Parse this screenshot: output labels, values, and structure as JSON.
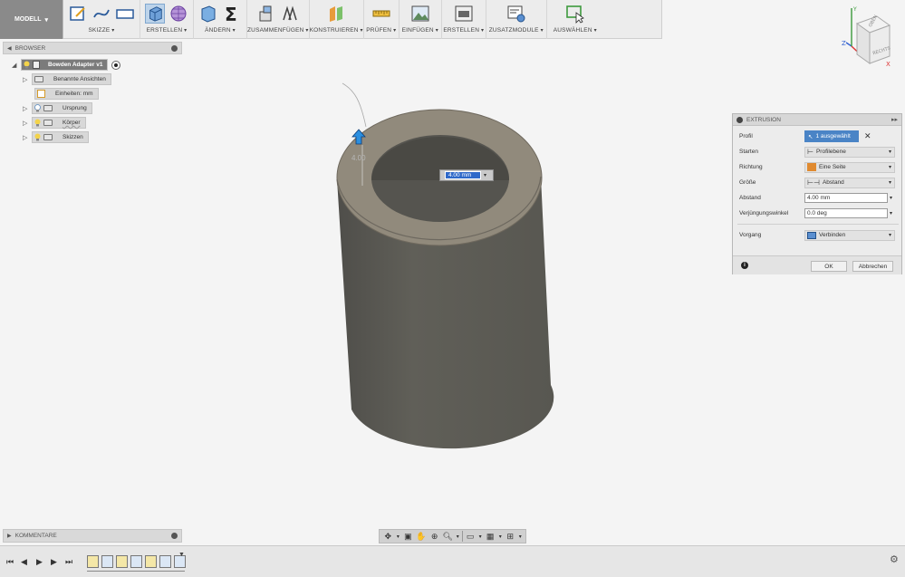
{
  "workspace": {
    "label": "MODELL"
  },
  "toolbar": {
    "groups": [
      {
        "label": "SKIZZE"
      },
      {
        "label": "ERSTELLEN"
      },
      {
        "label": "ÄNDERN"
      },
      {
        "label": "ZUSAMMENFÜGEN"
      },
      {
        "label": "KONSTRUIEREN"
      },
      {
        "label": "PRÜFEN"
      },
      {
        "label": "EINFÜGEN"
      },
      {
        "label": "ERSTELLEN"
      },
      {
        "label": "ZUSATZMODULE"
      },
      {
        "label": "AUSWÄHLEN"
      }
    ]
  },
  "browser": {
    "title": "BROWSER",
    "root": "Bowden Adapter v1",
    "items": [
      {
        "label": "Benannte Ansichten"
      },
      {
        "label": "Einheiten: mm"
      },
      {
        "label": "Ursprung"
      },
      {
        "label": "Körper"
      },
      {
        "label": "Skizzen"
      }
    ]
  },
  "viewcube": {
    "top": "OBEN",
    "right": "RECHTS",
    "axes": {
      "x": "X",
      "y": "Y",
      "z": "Z"
    }
  },
  "viewport": {
    "dim_label": "4.00",
    "dim_input_value": "4.00 mm",
    "body_color": "#5c5b55",
    "ring_color": "#918a7c"
  },
  "dialog": {
    "title": "EXTRUSION",
    "rows": {
      "profile": {
        "label": "Profil",
        "value": "1 ausgewählt"
      },
      "start": {
        "label": "Starten",
        "value": "Profilebene"
      },
      "direction": {
        "label": "Richtung",
        "value": "Eine Seite"
      },
      "extent": {
        "label": "Größe",
        "value": "Abstand"
      },
      "distance": {
        "label": "Abstand",
        "value": "4.00 mm"
      },
      "taper": {
        "label": "Verjüngungswinkel",
        "value": "0.0 deg"
      },
      "operation": {
        "label": "Vorgang",
        "value": "Verbinden"
      }
    },
    "ok": "OK",
    "cancel": "Abbrechen"
  },
  "comments": {
    "title": "KOMMENTARE"
  },
  "colors": {
    "accent": "#4a84c6",
    "toolbar": "#ececec",
    "viewport": "#f4f4f4"
  }
}
